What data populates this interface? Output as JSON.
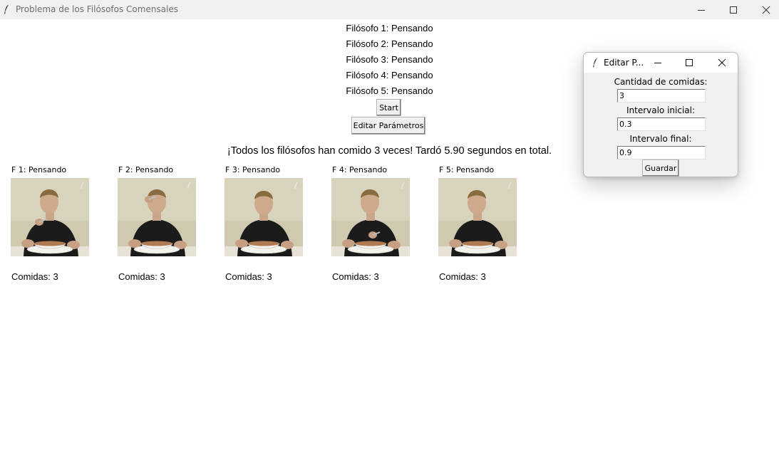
{
  "window": {
    "title": "Problema de los Filósofos Comensales"
  },
  "status_lines": [
    "Filósofo 1: Pensando",
    "Filósofo 2: Pensando",
    "Filósofo 3: Pensando",
    "Filósofo 4: Pensando",
    "Filósofo 5: Pensando"
  ],
  "buttons": {
    "start": "Start",
    "edit_params": "Editar Parámetros"
  },
  "summary": "¡Todos los filósofos han comido 3 veces! Tardó 5.90 segundos en total.",
  "philosophers": [
    {
      "label": "F 1: Pensando",
      "meals": "Comidas: 3"
    },
    {
      "label": "F 2: Pensando",
      "meals": "Comidas: 3"
    },
    {
      "label": "F 3: Pensando",
      "meals": "Comidas: 3"
    },
    {
      "label": "F 4: Pensando",
      "meals": "Comidas: 3"
    },
    {
      "label": "F 5: Pensando",
      "meals": "Comidas: 3"
    }
  ],
  "dialog": {
    "title": "Editar P...",
    "meals_label": "Cantidad de comidas:",
    "meals_value": "3",
    "interval_start_label": "Intervalo inicial:",
    "interval_start_value": "0.3",
    "interval_end_label": "Intervalo final:",
    "interval_end_value": "0.9",
    "save": "Guardar"
  },
  "icons": {
    "app": "feather-icon",
    "minimize": "minimize-icon",
    "maximize": "maximize-icon",
    "close": "close-icon"
  },
  "colors": {
    "titlebar_bg": "#f0f0f0",
    "title_text": "#6d6d6d",
    "dialog_bg": "#f0f0f0",
    "image_bg": "#cfcab3"
  }
}
